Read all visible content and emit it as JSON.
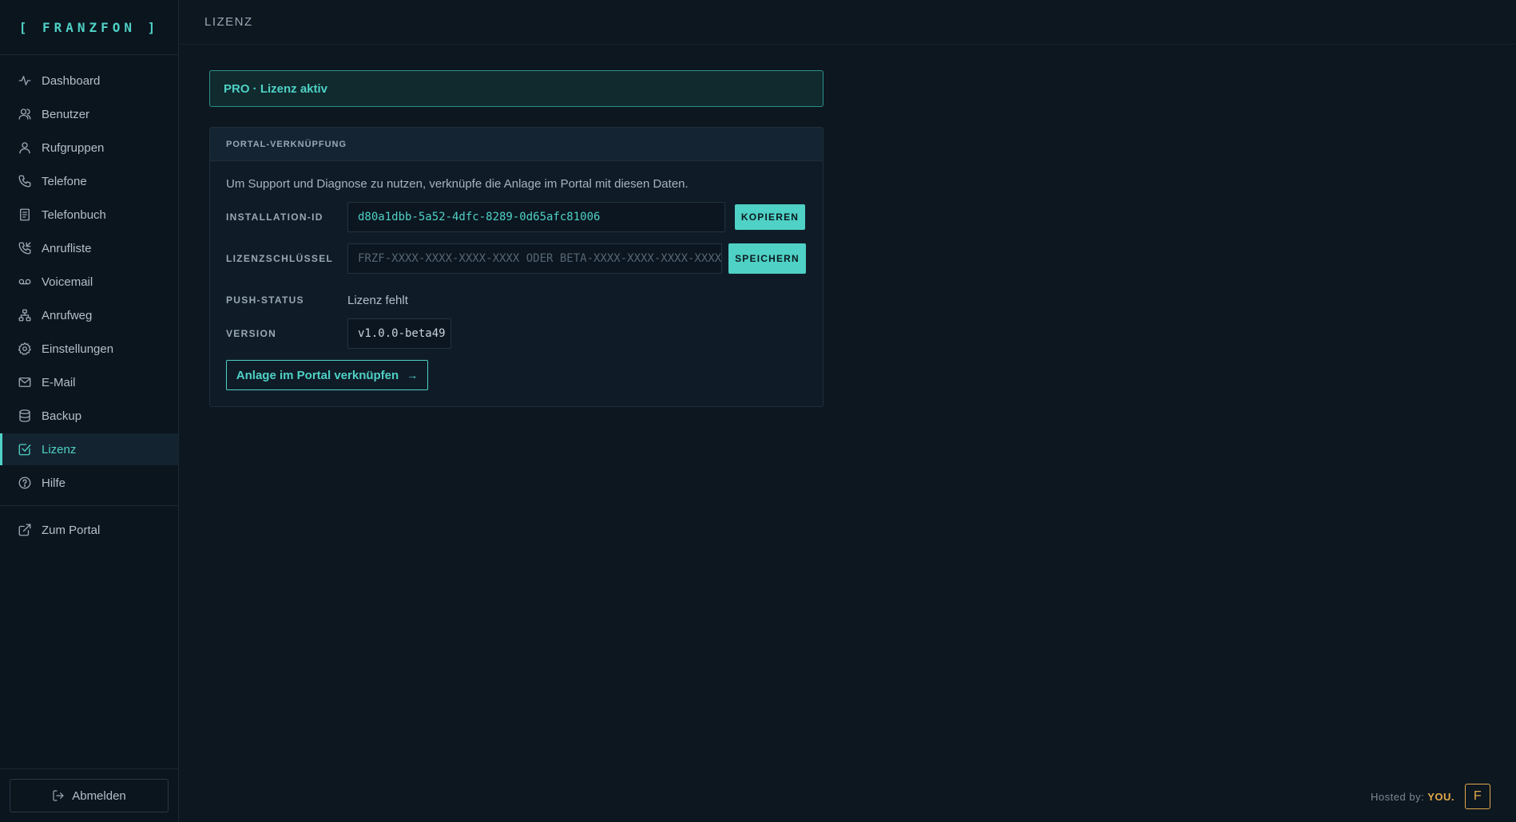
{
  "brand": "[ FRANZFON ]",
  "sidebar": {
    "items": [
      {
        "label": "Dashboard",
        "icon": "activity-icon"
      },
      {
        "label": "Benutzer",
        "icon": "user-icon"
      },
      {
        "label": "Rufgruppen",
        "icon": "users-icon"
      },
      {
        "label": "Telefone",
        "icon": "phone-icon"
      },
      {
        "label": "Telefonbuch",
        "icon": "book-icon"
      },
      {
        "label": "Anrufliste",
        "icon": "phone-incoming-icon"
      },
      {
        "label": "Voicemail",
        "icon": "voicemail-icon"
      },
      {
        "label": "Anrufweg",
        "icon": "network-icon"
      },
      {
        "label": "Einstellungen",
        "icon": "gear-icon"
      },
      {
        "label": "E-Mail",
        "icon": "mail-icon"
      },
      {
        "label": "Backup",
        "icon": "database-icon"
      },
      {
        "label": "Lizenz",
        "icon": "check-square-icon",
        "active": true
      },
      {
        "label": "Hilfe",
        "icon": "help-icon"
      }
    ],
    "portal": {
      "label": "Zum Portal",
      "icon": "external-link-icon"
    },
    "logout": {
      "label": "Abmelden",
      "icon": "logout-icon"
    }
  },
  "header": {
    "title": "LIZENZ"
  },
  "license": {
    "status": "PRO · Lizenz aktiv",
    "card_title": "PORTAL-VERKNÜPFUNG",
    "intro": "Um Support und Diagnose zu nutzen, verknüpfe die Anlage im Portal mit diesen Daten.",
    "installation_label": "INSTALLATION-ID",
    "installation_id": "d80a1dbb-5a52-4dfc-8289-0d65afc81006",
    "copy_label": "KOPIEREN",
    "key_label": "LIZENZSCHLÜSSEL",
    "key_placeholder": "FRZF-XXXX-XXXX-XXXX-XXXX ODER BETA-XXXX-XXXX-XXXX-XXXX",
    "save_label": "SPEICHERN",
    "push_label": "PUSH-STATUS",
    "push_value": "Lizenz fehlt",
    "version_label": "VERSION",
    "version_value": "v1.0.0-beta49",
    "link_button": "Anlage im Portal verknüpfen",
    "link_arrow": "→"
  },
  "footer": {
    "hosted_by": "Hosted by:",
    "host": "YOU.",
    "avatar_letter": "F"
  },
  "colors": {
    "accent": "#4fd1c5",
    "host_accent": "#e3a94a",
    "background": "#0d1720"
  }
}
